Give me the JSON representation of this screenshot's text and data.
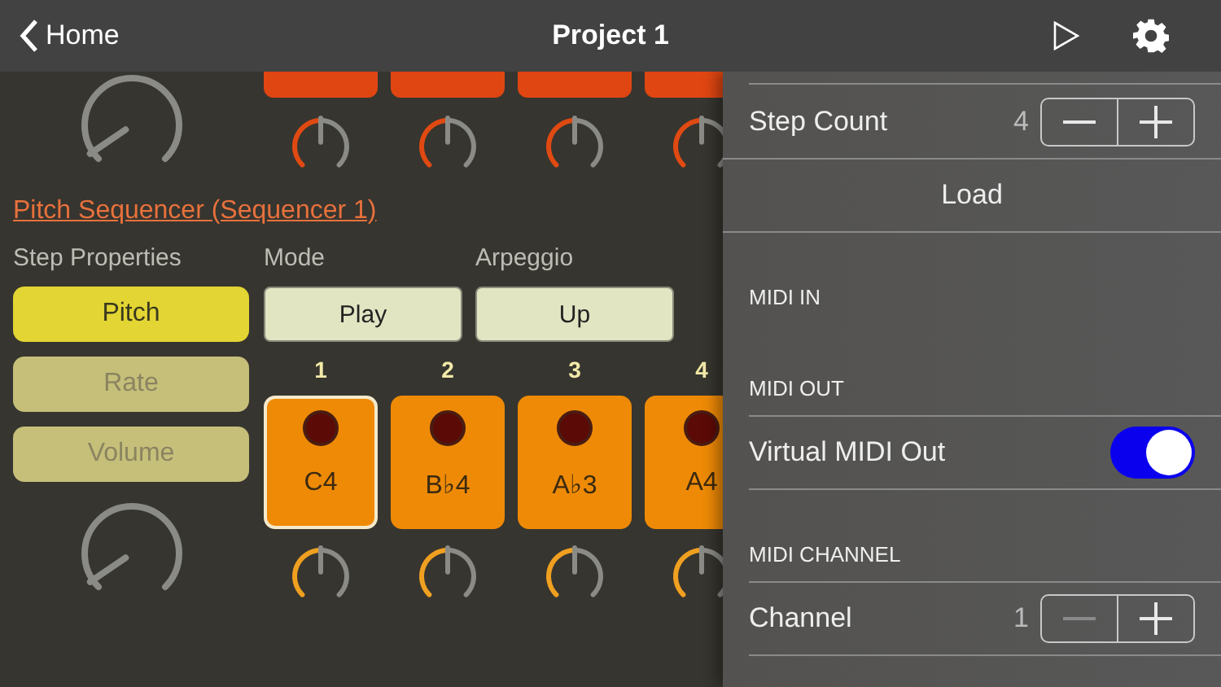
{
  "nav": {
    "back": "Home",
    "title": "Project 1"
  },
  "sequencer": {
    "title": "Pitch Sequencer (Sequencer 1)",
    "step_properties": {
      "label": "Step Properties",
      "options": [
        {
          "label": "Pitch",
          "selected": true
        },
        {
          "label": "Rate",
          "selected": false
        },
        {
          "label": "Volume",
          "selected": false
        }
      ]
    },
    "mode": {
      "label": "Mode",
      "value": "Play"
    },
    "arpeggio": {
      "label": "Arpeggio",
      "value": "Up"
    },
    "steps": [
      {
        "number": "1",
        "note": "C4",
        "selected": true
      },
      {
        "number": "2",
        "note": "B♭4",
        "selected": false
      },
      {
        "number": "3",
        "note": "A♭3",
        "selected": false
      },
      {
        "number": "4",
        "note": "A4",
        "selected": false
      }
    ]
  },
  "settings": [
    {
      "kind": "stepper",
      "label": "Step Count",
      "value": "4",
      "minus_disabled": false,
      "plus_disabled": false
    },
    {
      "kind": "button",
      "label": "Load"
    },
    {
      "kind": "header",
      "label": "MIDI IN"
    },
    {
      "kind": "header",
      "label": "MIDI OUT"
    },
    {
      "kind": "toggle",
      "label": "Virtual MIDI Out",
      "on": true
    },
    {
      "kind": "header",
      "label": "MIDI CHANNEL"
    },
    {
      "kind": "stepper",
      "label": "Channel",
      "value": "1",
      "minus_disabled": true,
      "plus_disabled": false
    }
  ]
}
